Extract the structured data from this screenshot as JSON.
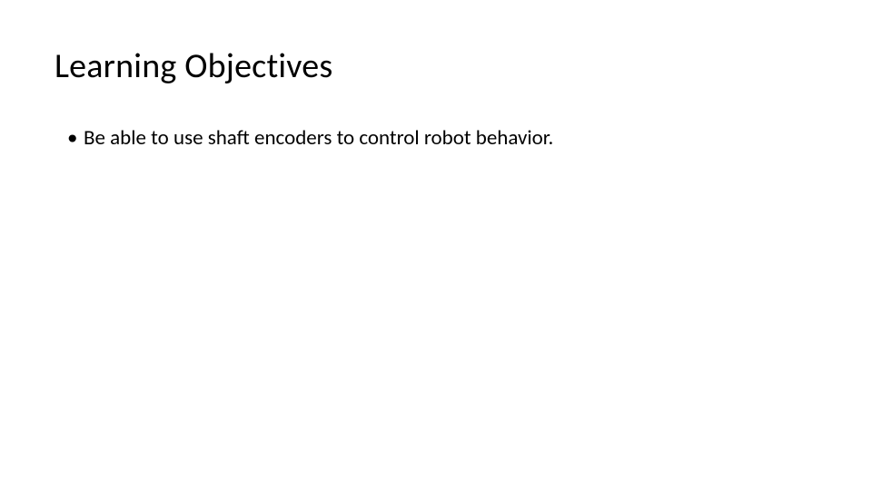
{
  "slide": {
    "title": "Learning Objectives",
    "bullets": [
      "Be able to use shaft encoders to control robot behavior."
    ]
  }
}
